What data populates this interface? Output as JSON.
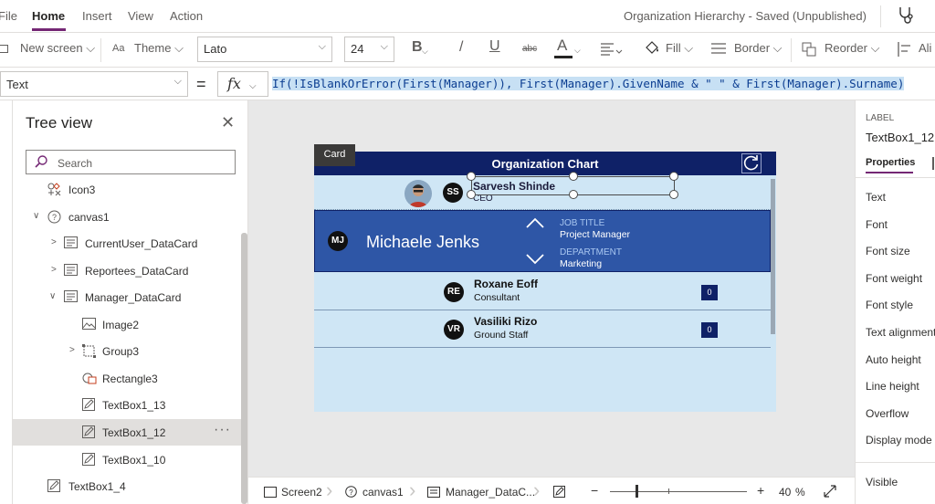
{
  "menu": {
    "items": [
      "File",
      "Home",
      "Insert",
      "View",
      "Action"
    ],
    "active": "Home",
    "document_title": "Organization Hierarchy - Saved (Unpublished)"
  },
  "ribbon": {
    "new_screen": "New screen",
    "theme": "Theme",
    "font": "Lato",
    "font_size": "24",
    "bold": "B",
    "italic": "/",
    "underline": "U",
    "strikethrough": "abc",
    "font_color": "A",
    "fill": "Fill",
    "border": "Border",
    "reorder": "Reorder",
    "align": "Ali"
  },
  "formula_bar": {
    "property": "Text",
    "equals": "=",
    "fx": "fx",
    "formula": "If(!IsBlankOrError(First(Manager)), First(Manager).GivenName & \" \" & First(Manager).Surname)"
  },
  "tree": {
    "title": "Tree view",
    "search_placeholder": "Search",
    "items": [
      {
        "label": "Icon3",
        "type": "icon"
      },
      {
        "label": "canvas1",
        "type": "canvas"
      },
      {
        "label": "CurrentUser_DataCard",
        "type": "card"
      },
      {
        "label": "Reportees_DataCard",
        "type": "card"
      },
      {
        "label": "Manager_DataCard",
        "type": "card"
      },
      {
        "label": "Image2",
        "type": "image"
      },
      {
        "label": "Group3",
        "type": "group"
      },
      {
        "label": "Rectangle3",
        "type": "shape"
      },
      {
        "label": "TextBox1_13",
        "type": "text"
      },
      {
        "label": "TextBox1_12",
        "type": "text"
      },
      {
        "label": "TextBox1_10",
        "type": "text"
      },
      {
        "label": "TextBox1_4",
        "type": "text"
      }
    ],
    "selected": "TextBox1_12",
    "more_label": "···"
  },
  "app": {
    "card_tooltip": "Card",
    "title": "Organization Chart",
    "manager": {
      "initials": "SS",
      "name": "Sarvesh Shinde",
      "title": "CEO"
    },
    "current_user": {
      "initials": "MJ",
      "name": "Michaele Jenks",
      "job_title_label": "JOB TITLE",
      "job_title": "Project Manager",
      "department_label": "DEPARTMENT",
      "department": "Marketing"
    },
    "reportees": [
      {
        "initials": "RE",
        "name": "Roxane Eoff",
        "role": "Consultant",
        "count": "0"
      },
      {
        "initials": "VR",
        "name": "Vasiliki Rizo",
        "role": "Ground Staff",
        "count": "0"
      }
    ]
  },
  "status_bar": {
    "breadcrumbs": [
      "Screen2",
      "canvas1",
      "Manager_DataC..."
    ],
    "zoom_minus": "−",
    "zoom_plus": "+",
    "zoom_value": "40",
    "zoom_unit": "%"
  },
  "properties": {
    "label_heading": "LABEL",
    "control_name": "TextBox1_12",
    "tab": "Properties",
    "rows": [
      "Text",
      "Font",
      "Font size",
      "Font weight",
      "Font style",
      "Text alignment",
      "Auto height",
      "Line height",
      "Overflow",
      "Display mode",
      "Visible"
    ]
  },
  "colors": {
    "accent": "#742774",
    "header_navy": "#0f2167",
    "card_blue": "#2e56a6",
    "canvas_light_blue": "#cfe6f5"
  }
}
